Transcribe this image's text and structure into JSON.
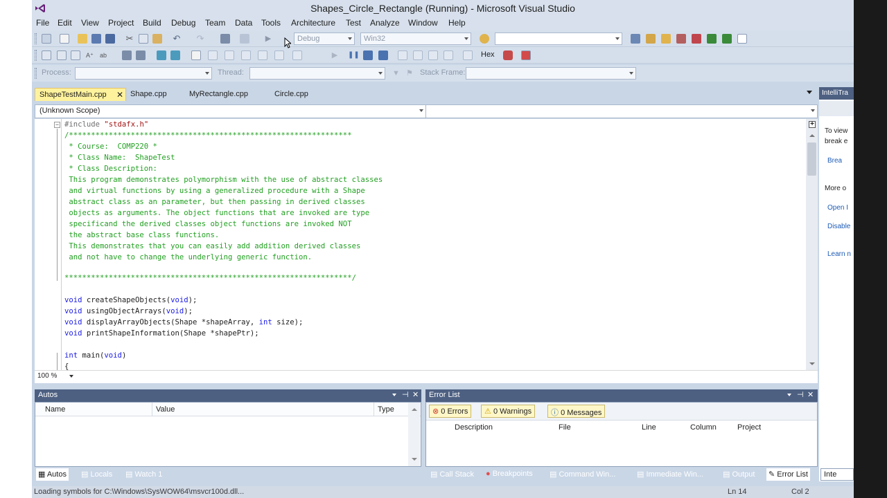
{
  "window": {
    "title": "Shapes_Circle_Rectangle (Running) - Microsoft Visual Studio"
  },
  "menu": [
    "File",
    "Edit",
    "View",
    "Project",
    "Build",
    "Debug",
    "Team",
    "Data",
    "Tools",
    "Architecture",
    "Test",
    "Analyze",
    "Window",
    "Help"
  ],
  "toolbar": {
    "config": "Debug",
    "platform": "Win32",
    "hex_label": "Hex"
  },
  "debug_location": {
    "process_label": "Process:",
    "thread_label": "Thread:",
    "stack_frame_label": "Stack Frame:"
  },
  "editor": {
    "tabs": [
      {
        "label": "ShapeTestMain.cpp",
        "active": true
      },
      {
        "label": "Shape.cpp",
        "active": false
      },
      {
        "label": "MyRectangle.cpp",
        "active": false
      },
      {
        "label": "Circle.cpp",
        "active": false
      }
    ],
    "scope": "(Unknown Scope)",
    "zoom": "100 %",
    "code": {
      "include_kw": "#include",
      "include_file": "\"stdafx.h\"",
      "banner_top": "/****************************************************************",
      "comment_lines": [
        " * Course:  COMP220 *",
        " * Class Name:  ShapeTest",
        " * Class Description:",
        " This program demonstrates polymorphism with the use of abstract classes",
        " and virtual functions by using a generalized procedure with a Shape",
        " abstract class as an parameter, but then passing in derived classes",
        " objects as arguments. The object functions that are invoked are type",
        " specificand the derived classes object functions are invoked NOT",
        " the abstract base class functions.",
        " This demonstrates that you can easily add addition derived classes",
        " and not have to change the underlying generic function."
      ],
      "banner_bottom": "*****************************************************************/",
      "decl1_kw": "void",
      "decl1_rest": " createShapeObjects(",
      "decl1_arg": "void",
      "decl1_end": ");",
      "decl2_kw": "void",
      "decl2_rest": " usingObjectArrays(",
      "decl2_arg": "void",
      "decl2_end": ");",
      "decl3_kw": "void",
      "decl3_rest": " displayArrayObjects(Shape *shapeArray, ",
      "decl3_int": "int",
      "decl3_end": " size);",
      "decl4_kw": "void",
      "decl4_rest": " printShapeInformation(Shape *shapePtr);",
      "main_kw": "int",
      "main_rest": " main(",
      "main_arg": "void",
      "main_end": ")",
      "brace": "{"
    }
  },
  "autos": {
    "title": "Autos",
    "columns": [
      "Name",
      "Value",
      "Type"
    ],
    "tabs": [
      "Autos",
      "Locals",
      "Watch 1"
    ]
  },
  "error_list": {
    "title": "Error List",
    "filters": [
      "0 Errors",
      "0 Warnings",
      "0 Messages"
    ],
    "columns": [
      "Description",
      "File",
      "Line",
      "Column",
      "Project"
    ],
    "tabs": [
      "Call Stack",
      "Breakpoints",
      "Command Win...",
      "Immediate Win...",
      "Output",
      "Error List"
    ]
  },
  "intellitrace": {
    "title": "IntelliTra",
    "lines": [
      "To view",
      "break e",
      "Brea",
      "More o",
      "Open I",
      "Disable",
      "Learn n"
    ],
    "bottom_tab": "Inte"
  },
  "status": {
    "message": "Loading symbols for C:\\Windows\\SysWOW64\\msvcr100d.dll...",
    "line": "Ln 14",
    "col": "Col 2"
  },
  "colors": {
    "chrome": "#c9d6e6",
    "panel_title": "#4d6082",
    "active_tab": "#fff29d",
    "keyword": "#1a1ae6",
    "comment": "#22a022"
  }
}
